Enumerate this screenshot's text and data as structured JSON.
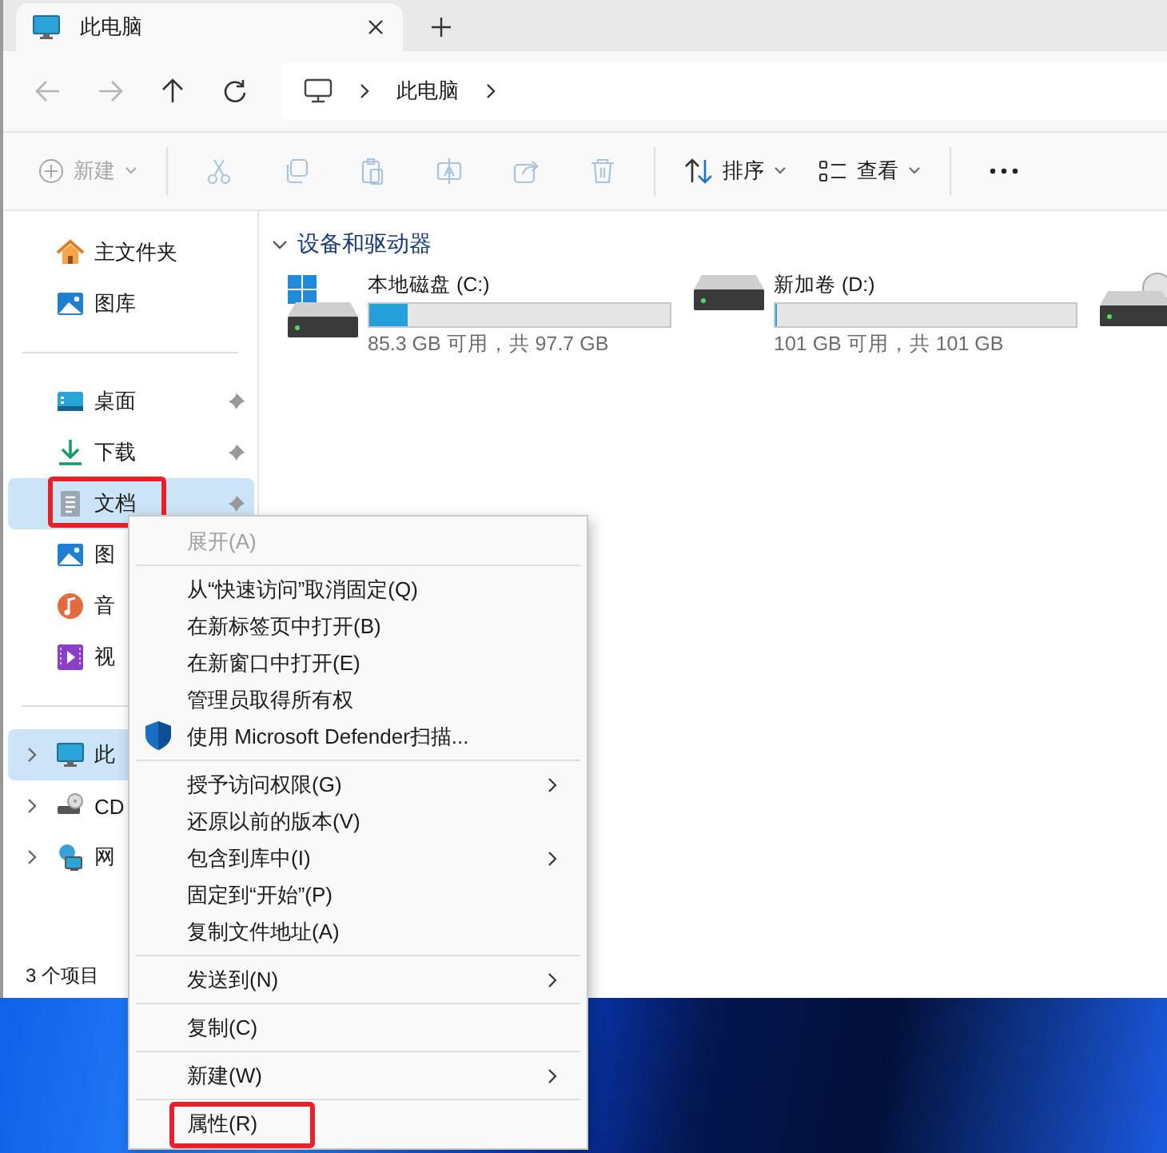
{
  "tabs": [
    {
      "title": "此电脑",
      "selected": true
    }
  ],
  "nav": [
    {
      "disabled": true
    },
    {
      "disabled": true
    },
    {
      "disabled": false
    },
    {
      "disabled": false
    }
  ],
  "address": {
    "segments": [
      "此电脑"
    ]
  },
  "toolbar": {
    "new": {
      "label": "新建",
      "disabled": true
    },
    "actions": [
      {
        "disabled": true
      },
      {
        "disabled": true
      },
      {
        "disabled": true
      },
      {
        "disabled": true
      },
      {
        "disabled": true
      },
      {
        "disabled": true
      }
    ],
    "sort": "排序",
    "view": "查看"
  },
  "sidebar": {
    "sections": [
      [
        {
          "label": "主文件夹",
          "selected": false,
          "pinned": false,
          "highlighted": false
        },
        {
          "label": "图库",
          "selected": false,
          "pinned": false,
          "highlighted": false
        }
      ],
      [
        {
          "label": "桌面",
          "selected": false,
          "pinned": true,
          "highlighted": false
        },
        {
          "label": "下载",
          "selected": false,
          "pinned": true,
          "highlighted": false
        },
        {
          "label": "文档",
          "selected": true,
          "pinned": true,
          "highlighted": true
        },
        {
          "label": "图",
          "selected": false,
          "pinned": false,
          "highlighted": false
        },
        {
          "label": "音",
          "selected": false,
          "pinned": false,
          "highlighted": false
        },
        {
          "label": "视",
          "selected": false,
          "pinned": false,
          "highlighted": false
        }
      ],
      [
        {
          "label": "此",
          "selected": true,
          "pinned": false,
          "highlighted": false,
          "expanded": false
        },
        {
          "label": "CD",
          "selected": false,
          "pinned": false,
          "highlighted": false,
          "expanded": false
        },
        {
          "label": "网",
          "selected": false,
          "pinned": false,
          "highlighted": false,
          "expanded": false
        }
      ]
    ]
  },
  "content": {
    "section": {
      "title": "设备和驱动器",
      "expanded": true
    },
    "drives": [
      {
        "name": "本地磁盘 (C:)",
        "level": 0.127,
        "space": "85.3 GB 可用，共 97.7 GB",
        "system": true
      },
      {
        "name": "新加卷 (D:)",
        "level": 0,
        "space": "101 GB 可用，共 101 GB",
        "system": false
      }
    ]
  },
  "status_bar": {
    "items": "3 个项目"
  },
  "context_menu": {
    "groups": [
      [
        {
          "label": "展开(A)",
          "disabled": true,
          "submenu": false,
          "kind": "text",
          "highlighted": false
        }
      ],
      [
        {
          "label": "从“快速访问”取消固定(Q)",
          "disabled": false,
          "submenu": false,
          "kind": "text",
          "highlighted": false
        },
        {
          "label": "在新标签页中打开(B)",
          "disabled": false,
          "submenu": false,
          "kind": "text",
          "highlighted": false
        },
        {
          "label": "在新窗口中打开(E)",
          "disabled": false,
          "submenu": false,
          "kind": "text",
          "highlighted": false
        },
        {
          "label": "管理员取得所有权",
          "disabled": false,
          "submenu": false,
          "kind": "text",
          "highlighted": false
        },
        {
          "label": "使用 Microsoft Defender扫描...",
          "disabled": false,
          "submenu": false,
          "kind": "icon",
          "highlighted": false
        }
      ],
      [
        {
          "label": "授予访问权限(G)",
          "disabled": false,
          "submenu": true,
          "kind": "text",
          "highlighted": false
        },
        {
          "label": "还原以前的版本(V)",
          "disabled": false,
          "submenu": false,
          "kind": "text",
          "highlighted": false
        },
        {
          "label": "包含到库中(I)",
          "disabled": false,
          "submenu": true,
          "kind": "text",
          "highlighted": false
        },
        {
          "label": "固定到“开始”(P)",
          "disabled": false,
          "submenu": false,
          "kind": "text",
          "highlighted": false
        },
        {
          "label": "复制文件地址(A)",
          "disabled": false,
          "submenu": false,
          "kind": "text",
          "highlighted": false
        }
      ],
      [
        {
          "label": "发送到(N)",
          "disabled": false,
          "submenu": true,
          "kind": "text",
          "highlighted": false
        }
      ],
      [
        {
          "label": "复制(C)",
          "disabled": false,
          "submenu": false,
          "kind": "text",
          "highlighted": false
        }
      ],
      [
        {
          "label": "新建(W)",
          "disabled": false,
          "submenu": true,
          "kind": "text",
          "highlighted": false
        }
      ],
      [
        {
          "label": "属性(R)",
          "disabled": false,
          "submenu": false,
          "kind": "text",
          "highlighted": true
        }
      ]
    ]
  }
}
